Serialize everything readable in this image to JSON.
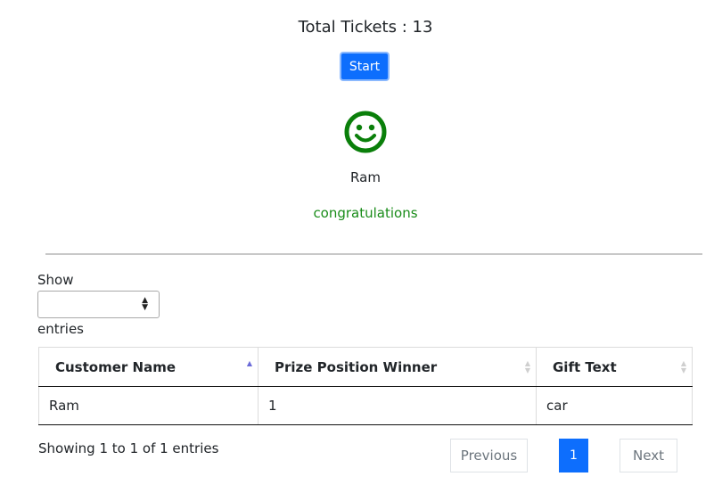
{
  "header": {
    "total_tickets": "Total Tickets : 13",
    "start_label": "Start"
  },
  "result": {
    "face": "smiley-face-icon",
    "winner_name": "Ram",
    "message": "congratulations",
    "message_color": "#198c19"
  },
  "table_controls": {
    "show_label": "Show",
    "selected_length": "",
    "entries_label": "entries"
  },
  "table": {
    "columns": [
      "Customer Name",
      "Prize Position Winner",
      "Gift Text"
    ],
    "rows": [
      [
        "Ram",
        "1",
        "car"
      ]
    ]
  },
  "footer": {
    "info": "Showing 1 to 1 of 1 entries",
    "previous_label": "Previous",
    "page_number": "1",
    "next_label": "Next"
  },
  "colors": {
    "accent": "#0d6efd",
    "face": "#0a7f0a"
  }
}
